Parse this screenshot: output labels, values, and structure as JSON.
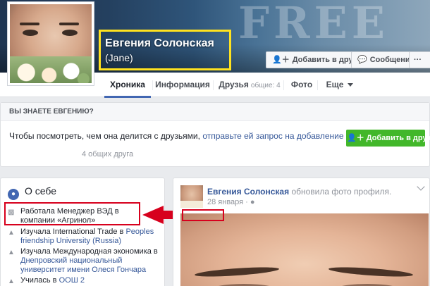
{
  "cover": {
    "ghost_text": "FREE"
  },
  "profile": {
    "name": "Евгения Солонская",
    "alt_name": "(Jane)"
  },
  "cover_buttons": {
    "add_friend": "Добавить в друзья",
    "message": "Сообщение",
    "more": "···"
  },
  "tabs": [
    {
      "label": "Хроника",
      "active": true
    },
    {
      "label": "Информация"
    },
    {
      "label": "Друзья",
      "sub": "общие: 4"
    },
    {
      "label": "Фото"
    },
    {
      "label": "Еще"
    }
  ],
  "know": {
    "header": "ВЫ ЗНАЕТЕ ЕВГЕНИЮ?",
    "text": "Чтобы посмотреть, чем она делится с друзьями, ",
    "link": "отправьте ей запрос на добавление в друзья",
    "suffix": ".",
    "mutual": "4 общих друга",
    "button": "Добавить в друзья"
  },
  "about": {
    "title": "О себе",
    "items": [
      {
        "icon": "briefcase-icon",
        "text": "Работала Менеджер ВЭД в компании «Агринол»"
      },
      {
        "icon": "graduation-cap-icon",
        "pre": "Изучала International Trade в ",
        "link": "Peoples friendship University (Russia)"
      },
      {
        "icon": "graduation-cap-icon",
        "pre": "Изучала Международная экономика в ",
        "link": "Днепровский национальный университет имени Олеся Гончара"
      },
      {
        "icon": "graduation-cap-icon",
        "pre": "Училась в ",
        "link": "ООШ 2"
      }
    ]
  },
  "post": {
    "author": "Евгения Солонская",
    "action": " обновила фото профиля.",
    "date": "28 января",
    "date_icon": "globe-icon"
  },
  "colors": {
    "fb_blue": "#4267b2",
    "link": "#365899",
    "green": "#42b72a",
    "highlight_yellow": "#ffe21f",
    "annotation_red": "#d7001d"
  }
}
